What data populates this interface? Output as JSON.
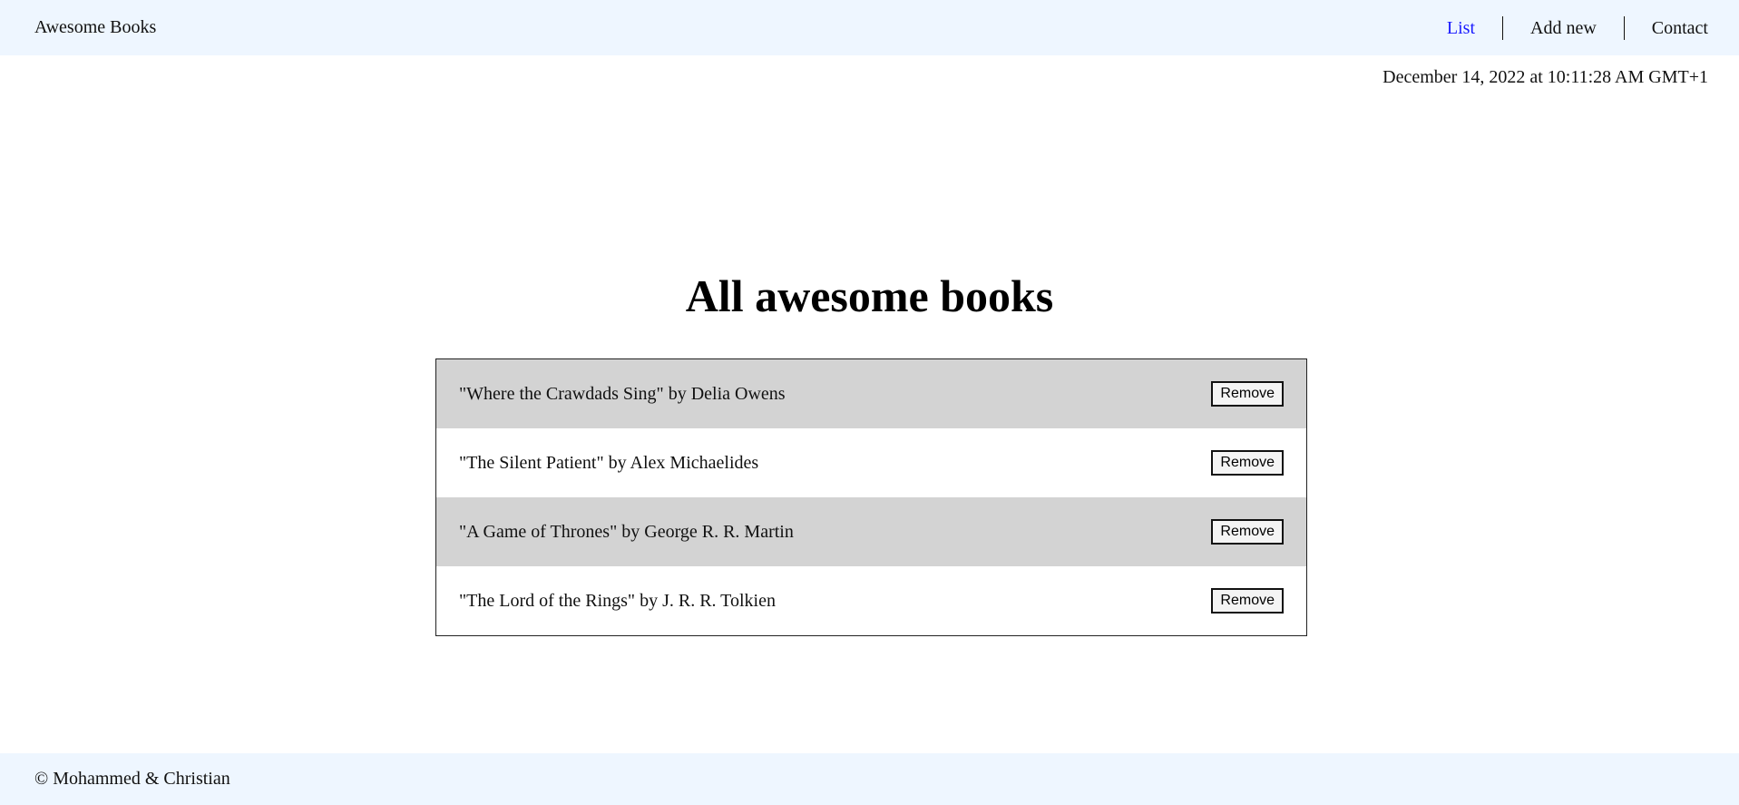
{
  "header": {
    "brand": "Awesome Books",
    "nav": [
      {
        "label": "List",
        "active": true
      },
      {
        "label": "Add new",
        "active": false
      },
      {
        "label": "Contact",
        "active": false
      }
    ]
  },
  "datetime": "December 14, 2022 at 10:11:28 AM GMT+1",
  "main": {
    "title": "All awesome books",
    "books": [
      {
        "text": "\"Where the Crawdads Sing\" by Delia Owens",
        "button": "Remove"
      },
      {
        "text": "\"The Silent Patient\" by Alex Michaelides",
        "button": "Remove"
      },
      {
        "text": "\"A Game of Thrones\" by George R. R. Martin",
        "button": "Remove"
      },
      {
        "text": "\"The Lord of the Rings\" by J. R. R. Tolkien",
        "button": "Remove"
      }
    ]
  },
  "footer": {
    "text": "© Mohammed & Christian"
  },
  "colors": {
    "navbar_bg": "#eef6ff",
    "active_link": "#1a1aff",
    "row_shaded": "#d3d3d3"
  }
}
